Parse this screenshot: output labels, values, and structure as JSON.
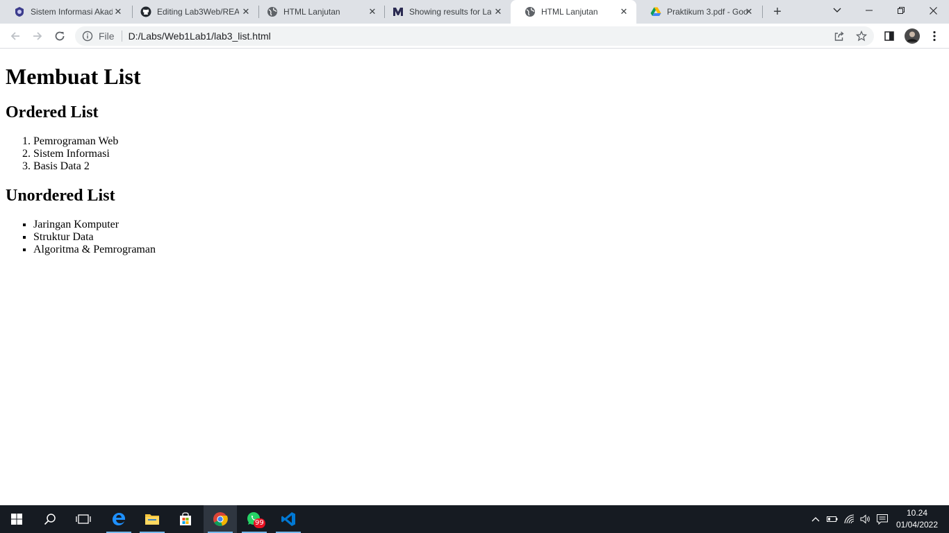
{
  "browser": {
    "tabs": [
      {
        "title": "Sistem Informasi Akad",
        "icon": "campus-crest-icon"
      },
      {
        "title": "Editing Lab3Web/REA",
        "icon": "github-icon"
      },
      {
        "title": "HTML Lanjutan",
        "icon": "globe-icon"
      },
      {
        "title": "Showing results for La",
        "icon": "m-logo-icon"
      },
      {
        "title": "HTML Lanjutan",
        "icon": "globe-icon",
        "active": true
      },
      {
        "title": "Praktikum 3.pdf - Goo",
        "icon": "google-drive-icon"
      }
    ],
    "new_tab_label": "+",
    "omnibox": {
      "scheme_label": "File",
      "url": "D:/Labs/Web1Lab1/lab3_list.html"
    }
  },
  "page": {
    "heading": "Membuat List",
    "ordered_heading": "Ordered List",
    "ordered_items": [
      "Pemrograman Web",
      "Sistem Informasi",
      "Basis Data 2"
    ],
    "unordered_heading": "Unordered List",
    "unordered_items": [
      "Jaringan Komputer",
      "Struktur Data",
      "Algoritma & Pemrograman"
    ]
  },
  "taskbar": {
    "apps": [
      "start",
      "search",
      "task-view",
      "edge",
      "file-explorer",
      "store",
      "chrome",
      "whatsapp",
      "vscode"
    ],
    "whatsapp_badge": "99",
    "clock_time": "10.24",
    "clock_date": "01/04/2022"
  },
  "colors": {
    "tabstrip": "#dee1e6",
    "taskbar": "#161b22",
    "accent": "#76b9ed"
  }
}
